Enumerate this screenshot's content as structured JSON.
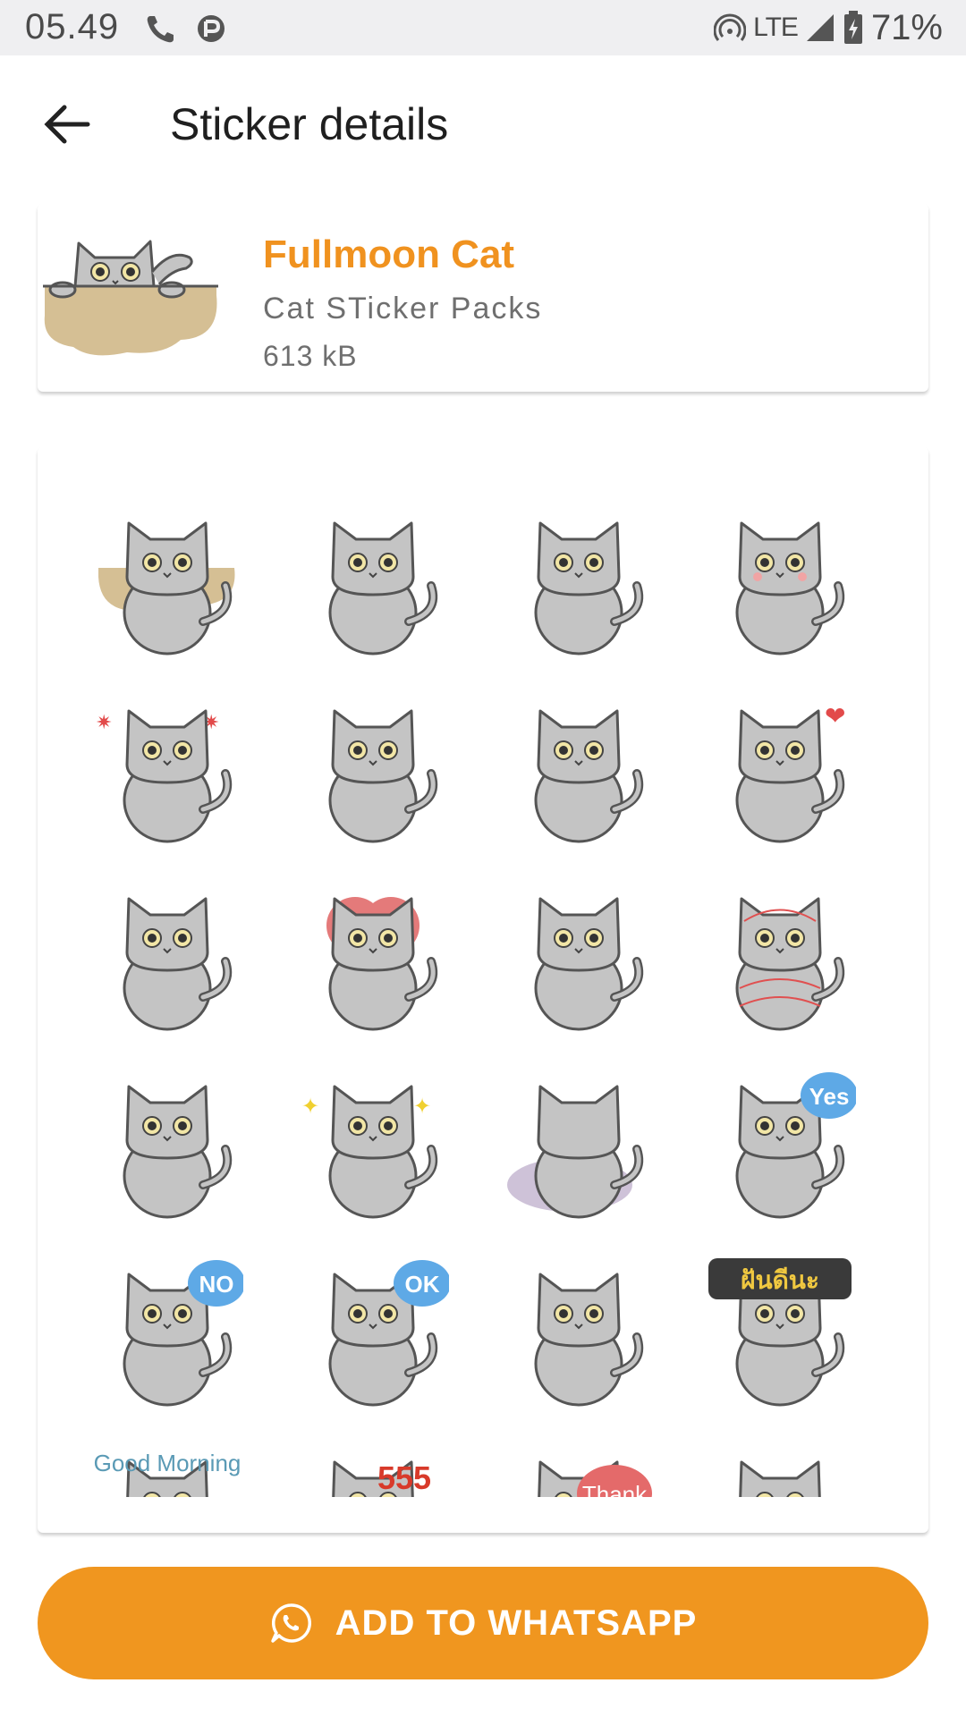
{
  "status_bar": {
    "time": "05.49",
    "network": "LTE",
    "battery": "71%",
    "icons": [
      "phone-icon",
      "parking-icon",
      "hotspot-icon",
      "signal-icon",
      "battery-charging-icon"
    ]
  },
  "app_bar": {
    "title": "Sticker details",
    "back_icon": "arrow-left-icon"
  },
  "pack": {
    "name": "Fullmoon Cat",
    "publisher": "Cat STicker Packs",
    "size": "613 kB"
  },
  "stickers": {
    "rows": 6,
    "columns": 4,
    "texts_visible": [
      "Yes",
      "NO",
      "OK",
      "ฝันดีนะ",
      "Good Morning",
      "555",
      "Thank"
    ]
  },
  "action": {
    "label": "ADD TO WHATSAPP",
    "icon": "whatsapp-icon"
  },
  "colors": {
    "accent": "#f0961f",
    "pack_name": "#f0921f",
    "cat_fill": "#c4c4c4",
    "status_bar": "#efeff1"
  }
}
